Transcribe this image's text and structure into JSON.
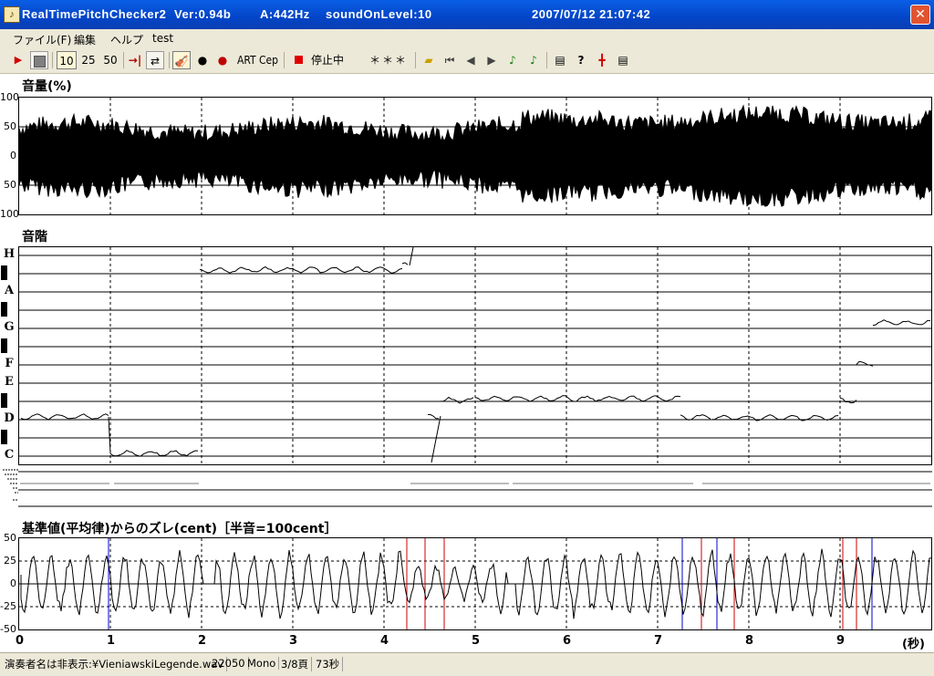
{
  "window": {
    "title": "RealTimePitchChecker2",
    "version": "Ver:0.94b",
    "a_freq": "A:442Hz",
    "sound_on_level": "soundOnLevel:10",
    "datetime": "2007/07/12 21:07:42"
  },
  "menu": {
    "file": "ファイル(F)",
    "edit": "編集",
    "help": "ヘルプ",
    "test": "test"
  },
  "toolbar": {
    "speed_10": "10",
    "speed_25": "25",
    "speed_50": "50",
    "art": "ART",
    "cep": "Cep",
    "status": "停止中",
    "indicator": "＊＊＊"
  },
  "volume_panel": {
    "title": "音量(%)",
    "yticks": [
      "100",
      "50",
      "0",
      "50",
      "100"
    ]
  },
  "pitch_panel": {
    "title": "音階",
    "notes": [
      "H",
      "A",
      "G",
      "F",
      "E",
      "D",
      "C"
    ]
  },
  "deviation_panel": {
    "title": "基準値(平均律)からのズレ(cent)［半音=100cent］",
    "yticks": [
      "50",
      "25",
      "0",
      "-25",
      "-50"
    ]
  },
  "time_axis": {
    "labels": [
      "0",
      "1",
      "2",
      "3",
      "4",
      "5",
      "6",
      "7",
      "8",
      "9"
    ],
    "unit": "(秒)"
  },
  "status": {
    "performer": "演奏者名は非表示:¥VieniawskiLegende.wav",
    "rate": "22050",
    "channels": "Mono",
    "page": "3/8頁",
    "duration": "73秒"
  }
}
